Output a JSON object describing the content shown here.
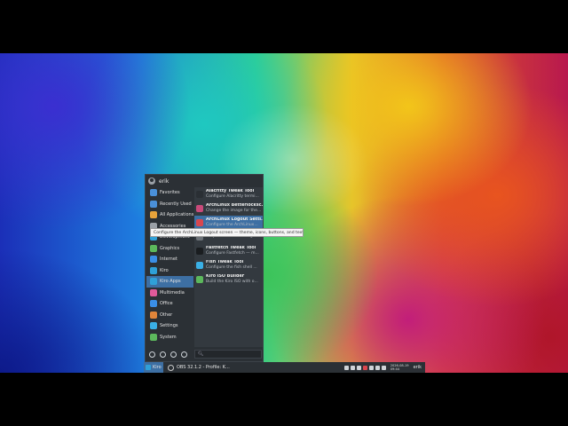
{
  "menu": {
    "user": "erik",
    "categories": [
      {
        "label": "Favorites",
        "icon": "folder-icon",
        "color": "#4a90d9"
      },
      {
        "label": "Recently Used",
        "icon": "folder-icon",
        "color": "#4a90d9"
      },
      {
        "label": "All Applications",
        "icon": "grid-icon",
        "color": "#e8a33a"
      },
      {
        "label": "Accessories",
        "icon": "wrench-icon",
        "color": "#9aa0a6"
      },
      {
        "label": "Development",
        "icon": "code-icon",
        "color": "#2fa0d8"
      },
      {
        "label": "Graphics",
        "icon": "palette-icon",
        "color": "#5cb85c"
      },
      {
        "label": "Internet",
        "icon": "globe-icon",
        "color": "#3a8ee6"
      },
      {
        "label": "Kiro",
        "icon": "kiro-icon",
        "color": "#2fa0d8"
      },
      {
        "label": "Kiro Apps",
        "icon": "kiro-icon",
        "color": "#2fa0d8"
      },
      {
        "label": "Multimedia",
        "icon": "music-icon",
        "color": "#e05a9a"
      },
      {
        "label": "Office",
        "icon": "document-icon",
        "color": "#3a8ee6"
      },
      {
        "label": "Other",
        "icon": "box-icon",
        "color": "#e0853a"
      },
      {
        "label": "Settings",
        "icon": "gear-icon",
        "color": "#3ab0e6"
      },
      {
        "label": "System",
        "icon": "system-icon",
        "color": "#5cb85c"
      }
    ],
    "selected_category": "Kiro Apps",
    "apps": [
      {
        "name": "Alacritty Tweak Tool",
        "desc": "Configure Alacritty termi...",
        "color": "#2a2f34"
      },
      {
        "name": "ArchLinux Betterlocksc...",
        "desc": "Change the image for the...",
        "color": "#c94a7a"
      },
      {
        "name": "ArchLinux Logout Setti...",
        "desc": "Configure the ArchLinux...",
        "color": "#d9474f"
      },
      {
        "name": "",
        "desc": "Graphical tool to configu...",
        "color": "#6c7278"
      },
      {
        "name": "Fastfetch Tweak Tool",
        "desc": "Configure Fastfetch — m...",
        "color": "#1a1d20"
      },
      {
        "name": "Fish Tweak Tool",
        "desc": "Configure the fish shell ...",
        "color": "#3ab0e6"
      },
      {
        "name": "Kiro ISO Builder",
        "desc": "Build the Kiro ISO with o...",
        "color": "#5cb85c"
      }
    ],
    "tooltip": "Configure the ArchLinux Logout screen — theme, icons, buttons, and text"
  },
  "taskbar": {
    "start_label": "Kiro",
    "task_label": "OBS 32.1.2 - Profile: K...",
    "clock_date": "2026-08-19",
    "clock_time": "09:44",
    "user": "erik"
  }
}
